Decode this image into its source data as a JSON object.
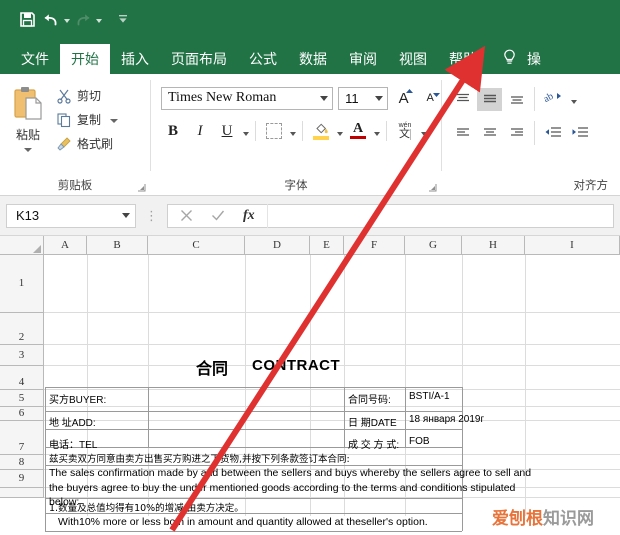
{
  "quick_access": {
    "items": [
      {
        "name": "save-icon",
        "label": "保存"
      },
      {
        "name": "undo-icon",
        "label": "撤销"
      },
      {
        "name": "redo-icon",
        "label": "恢复"
      },
      {
        "name": "customize-qat-icon",
        "label": "自定义快速访问工具栏"
      }
    ]
  },
  "ribbon": {
    "tabs": [
      {
        "label": "文件",
        "active": false
      },
      {
        "label": "开始",
        "active": true
      },
      {
        "label": "插入",
        "active": false
      },
      {
        "label": "页面布局",
        "active": false
      },
      {
        "label": "公式",
        "active": false
      },
      {
        "label": "数据",
        "active": false
      },
      {
        "label": "审阅",
        "active": false
      },
      {
        "label": "视图",
        "active": false
      },
      {
        "label": "帮助",
        "active": false
      }
    ],
    "tell_me": {
      "icon": "lightbulb-icon",
      "label": "操"
    },
    "clipboard": {
      "group_label": "剪贴板",
      "paste_label": "粘贴",
      "cut_label": "剪切",
      "copy_label": "复制",
      "format_painter_label": "格式刷"
    },
    "font": {
      "group_label": "字体",
      "font_name": "Times New Roman",
      "font_size": "11",
      "bold_label": "B",
      "italic_label": "I",
      "underline_label": "U",
      "grow_label": "A",
      "shrink_label": "A",
      "fill_color_label": "A",
      "font_color_label": "A",
      "phonetic_py": "wén",
      "phonetic_ch": "文"
    },
    "alignment": {
      "group_label": "对齐方"
    }
  },
  "formula_bar": {
    "name_box": "K13",
    "cancel_icon": "cancel-icon",
    "enter_icon": "confirm-icon",
    "function_icon": "insert-function-icon",
    "formula_value": ""
  },
  "grid": {
    "columns": [
      "A",
      "B",
      "C",
      "D",
      "E",
      "F",
      "G",
      "H",
      "I"
    ],
    "rows": [
      "1",
      "2",
      "3",
      "4",
      "5",
      "6",
      "7",
      "8",
      "9"
    ],
    "title_cn": "合同",
    "title_en": "CONTRACT",
    "labels": {
      "buyer": "买方BUYER:",
      "address": "地 址ADD:",
      "tel": "电话：TEL",
      "contract_no_label": "合同号码:",
      "contract_no_value": "BSTI/A-1",
      "date_label": "日  期DATE",
      "date_value": "18 января 2019г",
      "terms_label": "成 交 方 式:",
      "terms_value": "FOB"
    },
    "body": {
      "line_cn_1": "兹买卖双方同意由卖方出售买方购进之下货物,并按下列条款签订本合同:",
      "line_en_1": "The sales confirmation made by and between the sellers and buys whereby the sellers agree to sell and",
      "line_en_2": "the  buyers agree to buy the under mentioned goods according to the terms and conditions stipulated",
      "line_en_3": "below:",
      "line_cn_2": "1.数量及总值均得有10%的增减,由卖方决定。",
      "line_en_4": "With10% more or less both in amount and quantity allowed at theseller's option."
    }
  },
  "annotation": {
    "arrow_color": "#e03131",
    "arrow_name": "red-arrow-annotation"
  },
  "watermark": {
    "orange_text": "爱刨根",
    "gray_text": "知识网"
  },
  "colors": {
    "excel_green": "#217346",
    "accent_red": "#c00000",
    "highlight_yellow": "#ffd34d"
  }
}
